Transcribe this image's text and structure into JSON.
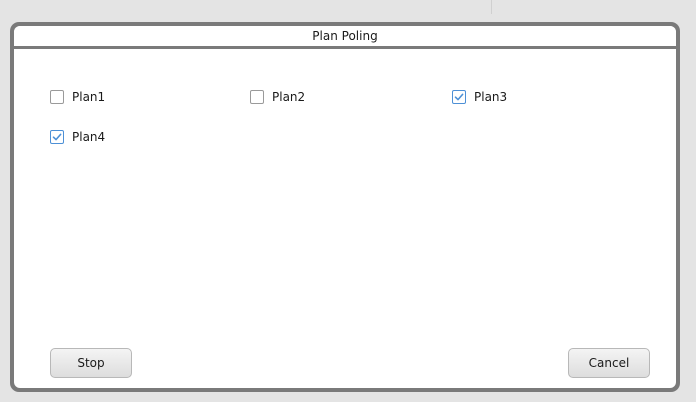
{
  "dialog": {
    "title": "Plan Poling"
  },
  "plans": [
    {
      "label": "Plan1",
      "checked": false
    },
    {
      "label": "Plan2",
      "checked": false
    },
    {
      "label": "Plan3",
      "checked": true
    },
    {
      "label": "Plan4",
      "checked": true
    }
  ],
  "buttons": {
    "stop_label": "Stop",
    "cancel_label": "Cancel"
  },
  "colors": {
    "check_accent": "#4d90d6",
    "dialog_border": "#7a7a7a"
  },
  "icons": {
    "checkmark": "checkmark-icon"
  }
}
